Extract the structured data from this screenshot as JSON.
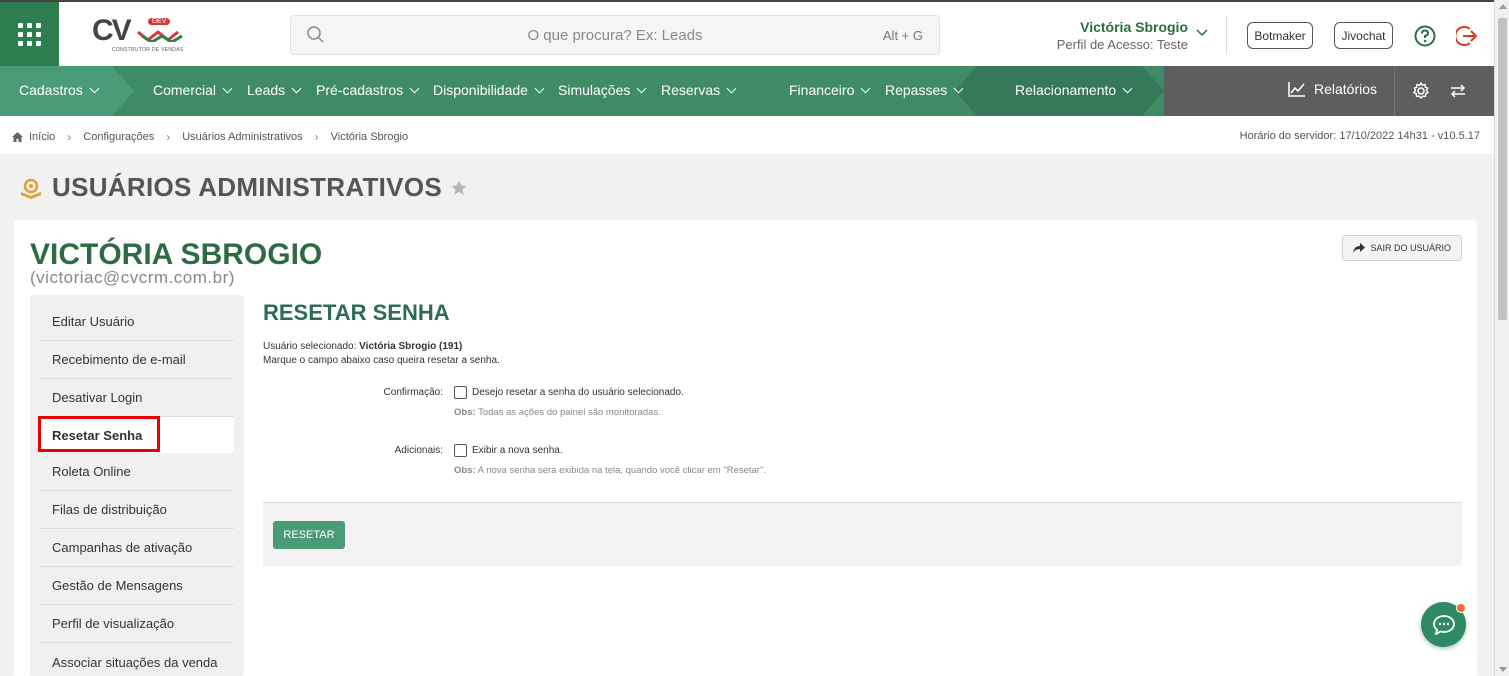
{
  "header": {
    "logo_text": "CV",
    "logo_badge": "DEV",
    "logo_sub": "CONSTRUTOR DE VENDAS",
    "search_placeholder": "O que procura? Ex: Leads",
    "search_shortcut": "Alt + G",
    "user_name": "Victória Sbrogio",
    "user_role": "Perfil de Acesso: Teste",
    "botmaker_label": "Botmaker",
    "jivochat_label": "Jivochat"
  },
  "nav": {
    "items": [
      {
        "label": "Cadastros"
      },
      {
        "label": "Comercial"
      },
      {
        "label": "Leads"
      },
      {
        "label": "Pré-cadastros"
      },
      {
        "label": "Disponibilidade"
      },
      {
        "label": "Simulações"
      },
      {
        "label": "Reservas"
      },
      {
        "label": "Financeiro"
      },
      {
        "label": "Repasses"
      },
      {
        "label": "Relacionamento"
      }
    ],
    "reports_label": "Relatórios"
  },
  "breadcrumb": {
    "items": [
      "Início",
      "Configurações",
      "Usuários Administrativos",
      "Victória Sbrogio"
    ],
    "server_time": "Horário do servidor: 17/10/2022 14h31 - v10.5.17"
  },
  "page": {
    "title": "USUÁRIOS ADMINISTRATIVOS",
    "user_name": "VICTÓRIA SBROGIO",
    "user_email": "(victoriac@cvcrm.com.br)",
    "logout_user_label": "SAIR DO USUÁRIO"
  },
  "sidebar": {
    "items": [
      {
        "label": "Editar Usuário"
      },
      {
        "label": "Recebimento de e-mail"
      },
      {
        "label": "Desativar Login"
      },
      {
        "label": "Resetar Senha"
      },
      {
        "label": "Roleta Online"
      },
      {
        "label": "Filas de distribuição"
      },
      {
        "label": "Campanhas de ativação"
      },
      {
        "label": "Gestão de Mensagens"
      },
      {
        "label": "Perfil de visualização"
      },
      {
        "label": "Associar situações da venda"
      }
    ],
    "active_index": 3
  },
  "form": {
    "title": "RESETAR SENHA",
    "selected_label": "Usuário selecionado:",
    "selected_value": "Victória Sbrogio (191)",
    "instruction": "Marque o campo abaixo caso queira resetar a senha.",
    "confirm_label": "Confirmação:",
    "confirm_text": "Desejo resetar a senha do usuário selecionado.",
    "confirm_obs_label": "Obs:",
    "confirm_obs": "Todas as ações do painel são monitoradas.",
    "extra_label": "Adicionais:",
    "extra_text": "Exibir a nova senha.",
    "extra_obs_label": "Obs:",
    "extra_obs": "A nova senha será exibida na tela, quando você clicar em \"Resetar\".",
    "reset_button": "RESETAR"
  },
  "colors": {
    "brand_green": "#2e7d4f",
    "nav_green_1": "#4a9b78",
    "nav_green_2": "#3f8b66",
    "nav_green_3": "#35795a",
    "nav_gray": "#5e5e5e",
    "logout_red": "#e03a1e"
  }
}
